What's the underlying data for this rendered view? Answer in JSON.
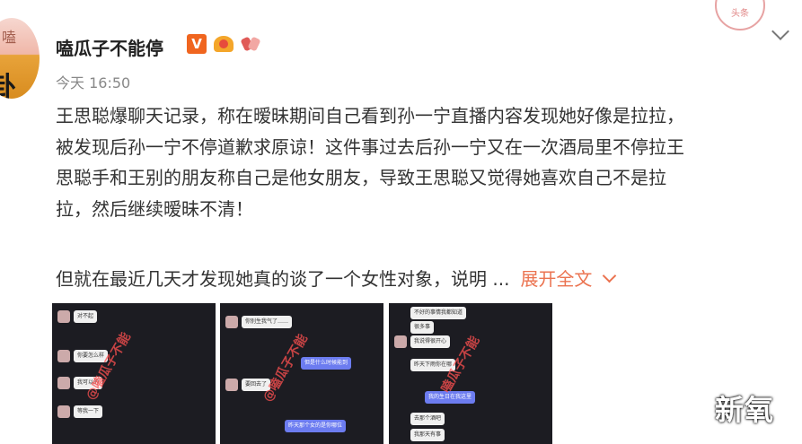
{
  "post": {
    "username": "嗑瓜子不能停",
    "avatar_text_top": "嗑",
    "avatar_text_bottom": "卦",
    "badge_v": "V",
    "timestamp": "今天 16:50",
    "stamp_text": "头条",
    "text_lines": [
      "王思聪爆聊天记录，称在暧昧期间自己看到孙一宁直播内容发现她好像是拉拉，",
      "被发现后孙一宁不停道歉求原谅！这件事过去后孙一宁又在一次酒局里不停拉王",
      "思聪手和王别的朋友称自己是他女朋友，导致王思聪又觉得她喜欢自己不是拉",
      "拉，然后继续暧昧不清！"
    ],
    "paragraph2": "但就在最近几天才发现她真的谈了一个女性对象，说明 ...",
    "expand_label": "展开全文"
  },
  "images": {
    "thumb1": {
      "watermark": "@嗑瓜子不能",
      "bubbles": [
        "对不起",
        "你要怎么样",
        "我可以的",
        "等我一下"
      ]
    },
    "thumb2": {
      "watermark": "@嗑瓜子不能",
      "bubbles": [
        "你别生我气了……",
        "但是什么时候能到",
        "要回去了",
        "昨天那个女的是你哪位"
      ]
    },
    "thumb3": {
      "watermark": "嗑瓜子不能",
      "bubbles": [
        "不好的事情我都知道",
        "很多事",
        "我说得很开心",
        "昨天下雨你在哪",
        "我的生日在我这里",
        "去那个酒吧",
        "我那天有事"
      ]
    },
    "corner_watermark": "新氧"
  },
  "colors": {
    "link": "#eb7350",
    "badge_v": "#f0651f",
    "text": "#333333",
    "muted": "#888888"
  },
  "icons": {
    "vip_badge": "v-badge-icon",
    "crown": "crown-icon",
    "bow": "bow-icon",
    "more": "chevron-down-icon"
  }
}
